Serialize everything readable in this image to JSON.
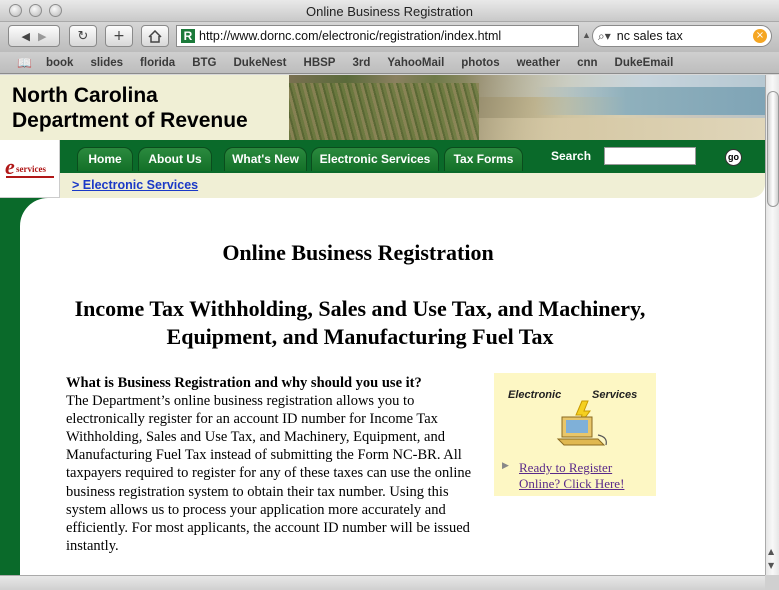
{
  "window": {
    "title": "Online Business Registration"
  },
  "toolbar": {
    "back_icon": "back-arrow-icon",
    "reload_icon": "reload-icon",
    "add_icon": "plus-icon",
    "home_icon": "home-icon",
    "url": "http://www.dornc.com/electronic/registration/index.html",
    "search_value": "nc sales tax"
  },
  "bookmarks": [
    "book",
    "slides",
    "florida",
    "BTG",
    "DukeNest",
    "HBSP",
    "3rd",
    "YahooMail",
    "photos",
    "weather",
    "cnn",
    "DukeEmail"
  ],
  "site": {
    "dept_line1": "North Carolina",
    "dept_line2": "Department of Revenue",
    "eservices_logo": "e-services",
    "nav_tabs": [
      "Home",
      "About Us",
      "What's New",
      "Electronic Services",
      "Tax Forms"
    ],
    "search_label": "Search",
    "go_label": "go",
    "breadcrumb": "> Electronic Services"
  },
  "content": {
    "title": "Online Business Registration",
    "subtitle": "Income Tax Withholding, Sales and Use Tax, and Machinery, Equipment, and Manufacturing Fuel Tax",
    "question": "What is Business Registration and why should you use it?",
    "paragraph": "The Department’s online business registration allows you to electronically register for an account ID number for Income Tax Withholding, Sales and Use Tax, and Machinery, Equipment, and Manufacturing Fuel Tax instead of submitting the Form NC-BR. All taxpayers required to register for any of these taxes can use the online business registration system to obtain their tax number. Using this system allows us to process your application more accurately and efficiently. For most applicants, the account ID number will be issued instantly.",
    "promo_label_left": "Electronic",
    "promo_label_right": "Services",
    "promo_link": "Ready to Register Online? Click Here!"
  },
  "colors": {
    "nav_green": "#0a6a2a",
    "cream": "#f0efd5",
    "link_blue": "#1a39c7",
    "promo_bg": "#fdf7c4"
  }
}
